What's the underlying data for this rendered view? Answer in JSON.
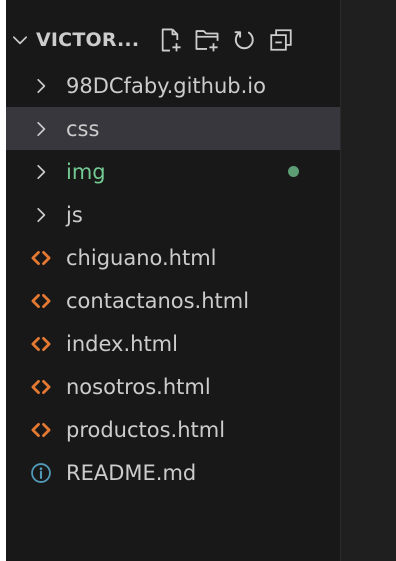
{
  "explorer": {
    "title": "VICTOR...",
    "actions": [
      {
        "name": "new-file",
        "icon": "new-file-icon"
      },
      {
        "name": "new-folder",
        "icon": "new-folder-icon"
      },
      {
        "name": "refresh",
        "icon": "refresh-icon"
      },
      {
        "name": "collapse-all",
        "icon": "collapse-all-icon"
      }
    ],
    "items": [
      {
        "label": "98DCfaby.github.io",
        "kind": "folder",
        "icon": "chevron-right-icon"
      },
      {
        "label": "css",
        "kind": "folder",
        "icon": "chevron-right-icon",
        "selected": true
      },
      {
        "label": "img",
        "kind": "folder",
        "icon": "chevron-right-icon",
        "modified": true
      },
      {
        "label": "js",
        "kind": "folder",
        "icon": "chevron-right-icon"
      },
      {
        "label": "chiguano.html",
        "kind": "file",
        "icon": "html-file-icon"
      },
      {
        "label": "contactanos.html",
        "kind": "file",
        "icon": "html-file-icon"
      },
      {
        "label": "index.html",
        "kind": "file",
        "icon": "html-file-icon"
      },
      {
        "label": "nosotros.html",
        "kind": "file",
        "icon": "html-file-icon"
      },
      {
        "label": "productos.html",
        "kind": "file",
        "icon": "html-file-icon"
      },
      {
        "label": "README.md",
        "kind": "file",
        "icon": "info-icon"
      }
    ]
  },
  "colors": {
    "background": "#181818",
    "text": "#cccccc",
    "selected_row": "#37373d",
    "modified": "#73c991",
    "html_icon": "#e37933",
    "info_icon": "#519aba"
  }
}
